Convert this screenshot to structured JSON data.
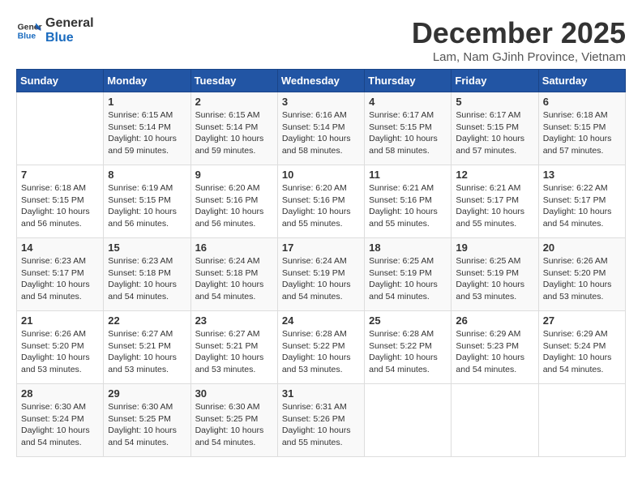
{
  "header": {
    "logo_line1": "General",
    "logo_line2": "Blue",
    "title": "December 2025",
    "subtitle": "Lam, Nam GJinh Province, Vietnam"
  },
  "weekdays": [
    "Sunday",
    "Monday",
    "Tuesday",
    "Wednesday",
    "Thursday",
    "Friday",
    "Saturday"
  ],
  "weeks": [
    [
      {
        "day": "",
        "info": ""
      },
      {
        "day": "1",
        "info": "Sunrise: 6:15 AM\nSunset: 5:14 PM\nDaylight: 10 hours\nand 59 minutes."
      },
      {
        "day": "2",
        "info": "Sunrise: 6:15 AM\nSunset: 5:14 PM\nDaylight: 10 hours\nand 59 minutes."
      },
      {
        "day": "3",
        "info": "Sunrise: 6:16 AM\nSunset: 5:14 PM\nDaylight: 10 hours\nand 58 minutes."
      },
      {
        "day": "4",
        "info": "Sunrise: 6:17 AM\nSunset: 5:15 PM\nDaylight: 10 hours\nand 58 minutes."
      },
      {
        "day": "5",
        "info": "Sunrise: 6:17 AM\nSunset: 5:15 PM\nDaylight: 10 hours\nand 57 minutes."
      },
      {
        "day": "6",
        "info": "Sunrise: 6:18 AM\nSunset: 5:15 PM\nDaylight: 10 hours\nand 57 minutes."
      }
    ],
    [
      {
        "day": "7",
        "info": "Sunrise: 6:18 AM\nSunset: 5:15 PM\nDaylight: 10 hours\nand 56 minutes."
      },
      {
        "day": "8",
        "info": "Sunrise: 6:19 AM\nSunset: 5:15 PM\nDaylight: 10 hours\nand 56 minutes."
      },
      {
        "day": "9",
        "info": "Sunrise: 6:20 AM\nSunset: 5:16 PM\nDaylight: 10 hours\nand 56 minutes."
      },
      {
        "day": "10",
        "info": "Sunrise: 6:20 AM\nSunset: 5:16 PM\nDaylight: 10 hours\nand 55 minutes."
      },
      {
        "day": "11",
        "info": "Sunrise: 6:21 AM\nSunset: 5:16 PM\nDaylight: 10 hours\nand 55 minutes."
      },
      {
        "day": "12",
        "info": "Sunrise: 6:21 AM\nSunset: 5:17 PM\nDaylight: 10 hours\nand 55 minutes."
      },
      {
        "day": "13",
        "info": "Sunrise: 6:22 AM\nSunset: 5:17 PM\nDaylight: 10 hours\nand 54 minutes."
      }
    ],
    [
      {
        "day": "14",
        "info": "Sunrise: 6:23 AM\nSunset: 5:17 PM\nDaylight: 10 hours\nand 54 minutes."
      },
      {
        "day": "15",
        "info": "Sunrise: 6:23 AM\nSunset: 5:18 PM\nDaylight: 10 hours\nand 54 minutes."
      },
      {
        "day": "16",
        "info": "Sunrise: 6:24 AM\nSunset: 5:18 PM\nDaylight: 10 hours\nand 54 minutes."
      },
      {
        "day": "17",
        "info": "Sunrise: 6:24 AM\nSunset: 5:19 PM\nDaylight: 10 hours\nand 54 minutes."
      },
      {
        "day": "18",
        "info": "Sunrise: 6:25 AM\nSunset: 5:19 PM\nDaylight: 10 hours\nand 54 minutes."
      },
      {
        "day": "19",
        "info": "Sunrise: 6:25 AM\nSunset: 5:19 PM\nDaylight: 10 hours\nand 53 minutes."
      },
      {
        "day": "20",
        "info": "Sunrise: 6:26 AM\nSunset: 5:20 PM\nDaylight: 10 hours\nand 53 minutes."
      }
    ],
    [
      {
        "day": "21",
        "info": "Sunrise: 6:26 AM\nSunset: 5:20 PM\nDaylight: 10 hours\nand 53 minutes."
      },
      {
        "day": "22",
        "info": "Sunrise: 6:27 AM\nSunset: 5:21 PM\nDaylight: 10 hours\nand 53 minutes."
      },
      {
        "day": "23",
        "info": "Sunrise: 6:27 AM\nSunset: 5:21 PM\nDaylight: 10 hours\nand 53 minutes."
      },
      {
        "day": "24",
        "info": "Sunrise: 6:28 AM\nSunset: 5:22 PM\nDaylight: 10 hours\nand 53 minutes."
      },
      {
        "day": "25",
        "info": "Sunrise: 6:28 AM\nSunset: 5:22 PM\nDaylight: 10 hours\nand 54 minutes."
      },
      {
        "day": "26",
        "info": "Sunrise: 6:29 AM\nSunset: 5:23 PM\nDaylight: 10 hours\nand 54 minutes."
      },
      {
        "day": "27",
        "info": "Sunrise: 6:29 AM\nSunset: 5:24 PM\nDaylight: 10 hours\nand 54 minutes."
      }
    ],
    [
      {
        "day": "28",
        "info": "Sunrise: 6:30 AM\nSunset: 5:24 PM\nDaylight: 10 hours\nand 54 minutes."
      },
      {
        "day": "29",
        "info": "Sunrise: 6:30 AM\nSunset: 5:25 PM\nDaylight: 10 hours\nand 54 minutes."
      },
      {
        "day": "30",
        "info": "Sunrise: 6:30 AM\nSunset: 5:25 PM\nDaylight: 10 hours\nand 54 minutes."
      },
      {
        "day": "31",
        "info": "Sunrise: 6:31 AM\nSunset: 5:26 PM\nDaylight: 10 hours\nand 55 minutes."
      },
      {
        "day": "",
        "info": ""
      },
      {
        "day": "",
        "info": ""
      },
      {
        "day": "",
        "info": ""
      }
    ]
  ]
}
